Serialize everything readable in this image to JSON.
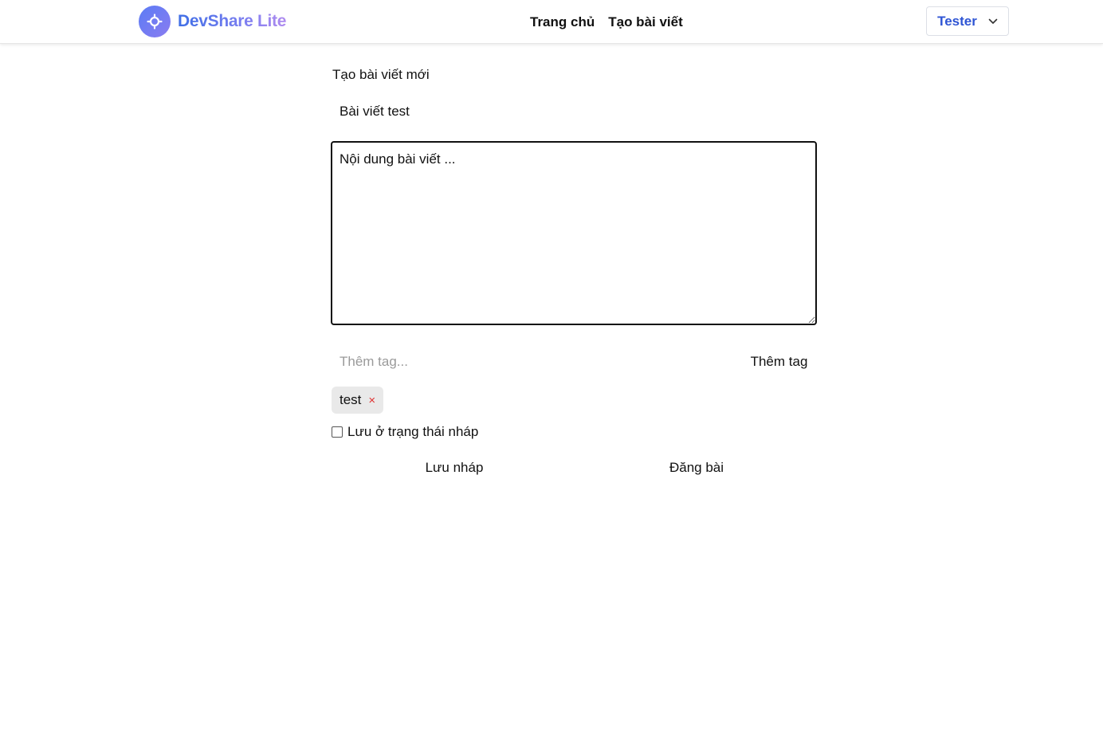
{
  "brand": {
    "name": "DevShare Lite"
  },
  "nav": {
    "links": [
      "Trang chủ",
      "Tạo bài viết"
    ]
  },
  "user": {
    "name": "Tester"
  },
  "form": {
    "heading": "Tạo bài viết mới",
    "title_value": "Bài viết test",
    "content_value": "Nội dung bài viết ...",
    "tag_placeholder": "Thêm tag...",
    "add_tag_label": "Thêm tag",
    "tags": [
      {
        "label": "test",
        "remove_symbol": "×"
      }
    ],
    "draft_label": "Lưu ở trạng thái nháp",
    "draft_checked": false,
    "save_draft_label": "Lưu nháp",
    "publish_label": "Đăng bài"
  },
  "icons": {
    "logo": "compass-icon",
    "user_menu": "chevron-down-icon"
  },
  "colors": {
    "brand_start": "#3f6fe6",
    "brand_end": "#b08bef",
    "user_name": "#2f55d4",
    "tag_remove": "#e03131"
  }
}
